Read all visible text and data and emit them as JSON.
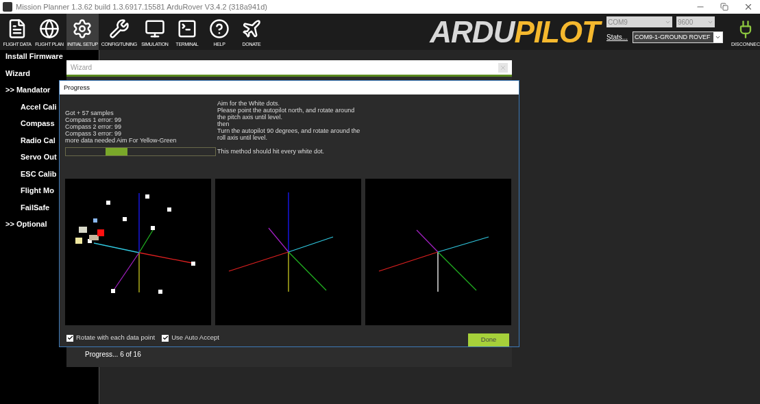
{
  "window": {
    "title": "Mission Planner 1.3.62 build 1.3.6917.15581 ArduRover V3.4.2 (318a941d)"
  },
  "toolbar": {
    "items": [
      {
        "label": "FLIGHT DATA",
        "kind": "data",
        "selected": false
      },
      {
        "label": "FLIGHT PLAN",
        "kind": "plan",
        "selected": false
      },
      {
        "label": "INITIAL SETUP",
        "kind": "setup",
        "selected": true
      },
      {
        "label": "CONFIG/TUNING",
        "kind": "config",
        "selected": false
      },
      {
        "label": "SIMULATION",
        "kind": "simulation",
        "selected": false
      },
      {
        "label": "TERMINAL",
        "kind": "terminal",
        "selected": false
      },
      {
        "label": "HELP",
        "kind": "help",
        "selected": false
      },
      {
        "label": "DONATE",
        "kind": "donate",
        "selected": false
      }
    ],
    "logo": {
      "part_1": "ARDU",
      "part_2": "PILOT"
    },
    "port": "COM9",
    "baud": "9600",
    "stats_link": "Stats...",
    "connection": "COM9-1-GROUND ROVEF",
    "disconnect": "DISCONNEC"
  },
  "sidebar": {
    "items": [
      {
        "label": "Install Firmware",
        "kind": "top"
      },
      {
        "label": "Wizard",
        "kind": "top"
      },
      {
        "label": ">> Mandator",
        "kind": "top"
      },
      {
        "label": "Accel Cali",
        "kind": "sub"
      },
      {
        "label": "Compass",
        "kind": "sub"
      },
      {
        "label": "Radio Cal",
        "kind": "sub"
      },
      {
        "label": "Servo Out",
        "kind": "sub"
      },
      {
        "label": "ESC Calib",
        "kind": "sub"
      },
      {
        "label": "Flight Mo",
        "kind": "sub"
      },
      {
        "label": "FailSafe",
        "kind": "sub"
      },
      {
        "label": ">> Optional",
        "kind": "top"
      }
    ]
  },
  "wizard": {
    "title": "Wizard",
    "status": "Progress... 6 of 16"
  },
  "progress_dialog": {
    "title": "Progress",
    "status_lines": [
      "Got + 57 samples",
      "Compass 1 error: 99",
      "Compass 2 error: 99",
      "Compass 3 error: 99",
      "more data needed Aim For Yellow-Green"
    ],
    "instructions": [
      "Aim for the White dots.",
      "Please point the autopilot north, and rotate around",
      "the pitch axis until level.",
      "then",
      "Turn the autopilot 90 degrees, and rotate around the",
      "roll axis until level."
    ],
    "note": "This method should hit every white dot.",
    "options": [
      {
        "label": "Rotate with each data point",
        "checked": true
      },
      {
        "label": "Use Auto Accept",
        "checked": true
      }
    ],
    "done_button": "Done"
  }
}
